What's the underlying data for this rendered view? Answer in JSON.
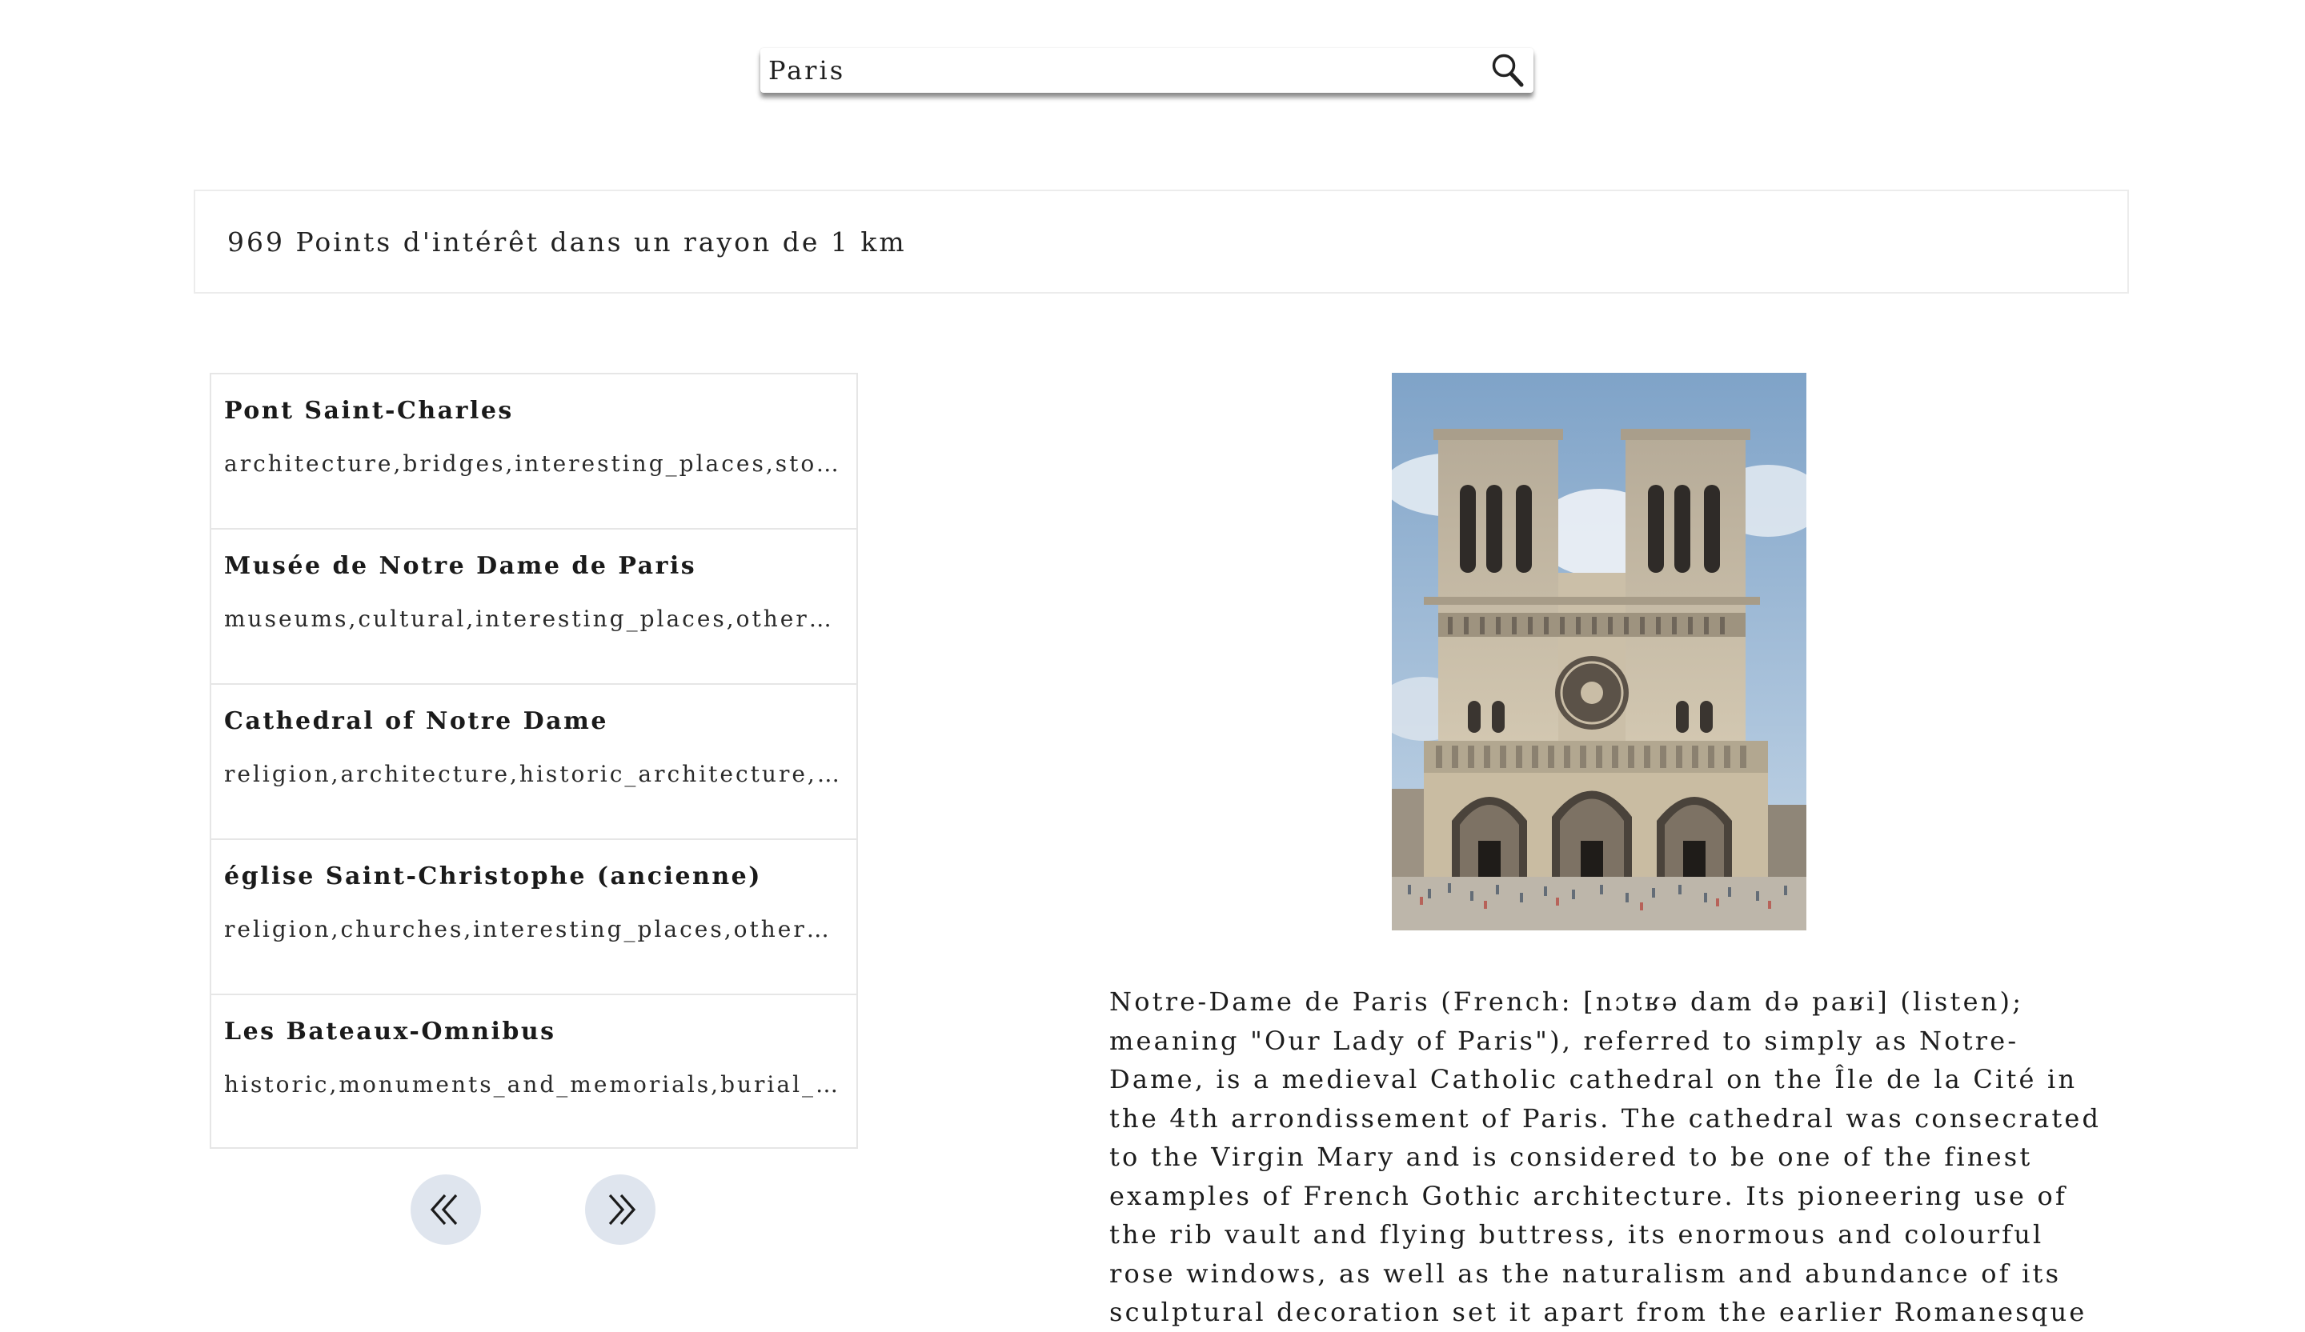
{
  "search": {
    "value": "Paris",
    "icon": "search-icon"
  },
  "results": {
    "summary": "969 Points d'intérêt dans un rayon de 1 km"
  },
  "places": [
    {
      "name": "Pont Saint-Charles",
      "kinds": "architecture,bridges,interesting_places,sto..."
    },
    {
      "name": "Musée de Notre Dame de Paris",
      "kinds": "museums,cultural,interesting_places,other_..."
    },
    {
      "name": "Cathedral of Notre Dame",
      "kinds": "religion,architecture,historic_architecture,..."
    },
    {
      "name": "église Saint-Christophe (ancienne)",
      "kinds": "religion,churches,interesting_places,other_..."
    },
    {
      "name": "Les Bateaux-Omnibus",
      "kinds": "historic,monuments_and_memorials,burial_..."
    }
  ],
  "pagination": {
    "prev_icon": "double-chevron-left-icon",
    "next_icon": "double-chevron-right-icon"
  },
  "detail": {
    "description": "Notre-Dame de Paris (French: [nɔtʁə dam də paʁi] (listen); meaning \"Our Lady of Paris\"), referred to simply as Notre-Dame, is a medieval Catholic cathedral on the Île de la Cité in the 4th arrondissement of Paris. The cathedral was consecrated to the Virgin Mary and is considered to be one of the finest examples of French Gothic architecture. Its pioneering use of the rib vault and flying buttress, its enormous and colourful rose windows, as well as the naturalism and abundance of its sculptural decoration set it apart from the earlier Romanesque"
  },
  "colors": {
    "page_bg": "#ffffff",
    "border": "#e6e6e6",
    "pager_bg": "#dfe5ee",
    "text": "#1f1f1f"
  }
}
